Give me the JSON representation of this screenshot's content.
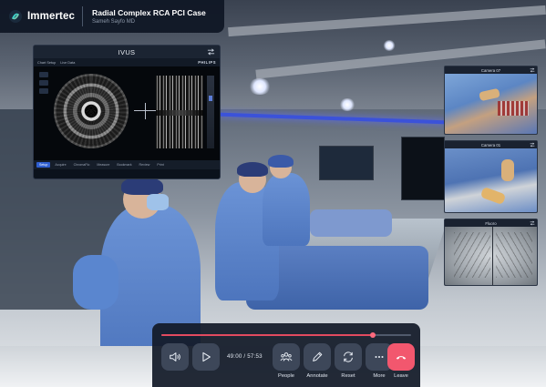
{
  "header": {
    "brand": "Immertec",
    "title": "Radial Complex RCA PCI Case",
    "presenter": "Sameh Sayfo MD"
  },
  "ivus_panel": {
    "title": "IVUS",
    "toolbar": {
      "left_label": "Chart Setup",
      "center_label": "Live Data",
      "vendor": "PHILIPS"
    },
    "tabs": [
      "Setup",
      "Acquire",
      "ChromaFlo",
      "Measure",
      "Bookmark",
      "Review",
      "Print"
    ],
    "active_tab": "Setup"
  },
  "camera_feeds": [
    {
      "title": "Camera 07"
    },
    {
      "title": "Camera 01"
    },
    {
      "title": "Fluoro"
    }
  ],
  "controls": {
    "progress": 0.845,
    "elapsed": "49:00",
    "total": "57:53",
    "time_display": "49:00 / 57:53",
    "buttons": {
      "volume": {
        "icon": "speaker-icon"
      },
      "play": {
        "icon": "play-icon"
      },
      "people": {
        "label": "People",
        "icon": "people-icon"
      },
      "annotate": {
        "label": "Annotate",
        "icon": "pencil-icon"
      },
      "reset": {
        "label": "Reset",
        "icon": "reset-icon"
      },
      "more": {
        "label": "More",
        "icon": "more-icon"
      },
      "leave": {
        "label": "Leave",
        "icon": "hang-up-icon",
        "color": "#f2576e"
      }
    },
    "accent": "#e24a60"
  }
}
